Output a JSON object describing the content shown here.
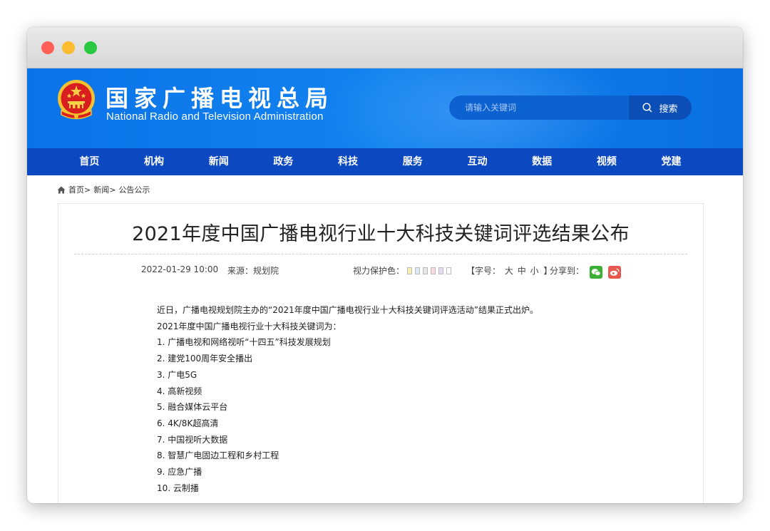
{
  "site": {
    "name_cn": "国家广播电视总局",
    "name_en": "National Radio and Television Administration"
  },
  "search": {
    "placeholder": "请输入关键词",
    "button_label": "搜索"
  },
  "nav": [
    "首页",
    "机构",
    "新闻",
    "政务",
    "科技",
    "服务",
    "互动",
    "数据",
    "视频",
    "党建"
  ],
  "breadcrumb": [
    "首页>",
    "新闻>",
    "公告公示"
  ],
  "article": {
    "title": "2021年度中国广播电视行业十大科技关键词评选结果公布",
    "date": "2022-01-29 10:00",
    "source": "来源：规划院",
    "eye_care_label": "视力保护色：",
    "eye_care_colors": [
      "#f7eeb4",
      "#dbe9f7",
      "#e8e8e8",
      "#f8dbe1",
      "#e7ddf4",
      "#ffffff"
    ],
    "font_size_open": "【字号：",
    "font_sizes": [
      "大",
      "中",
      "小"
    ],
    "font_size_close": "】",
    "share_label": "分享到：",
    "paragraphs": [
      "近日，广播电视规划院主办的“2021年度中国广播电视行业十大科技关键词评选活动”结果正式出炉。",
      "2021年度中国广播电视行业十大科技关键词为：",
      "1. 广播电视和网络视听“十四五”科技发展规划",
      "2. 建党100周年安全播出",
      "3. 广电5G",
      "4. 高新视频",
      "5. 融合媒体云平台",
      "6. 4K/8K超高清",
      "7. 中国视听大数据",
      "8. 智慧广电固边工程和乡村工程",
      "9. 应急广播",
      "10. 云制播"
    ]
  },
  "colors": {
    "header_blue": "#1383f0",
    "nav_blue": "#0c48bf",
    "wechat_green": "#3cb034",
    "weibo_red": "#e8584e"
  }
}
